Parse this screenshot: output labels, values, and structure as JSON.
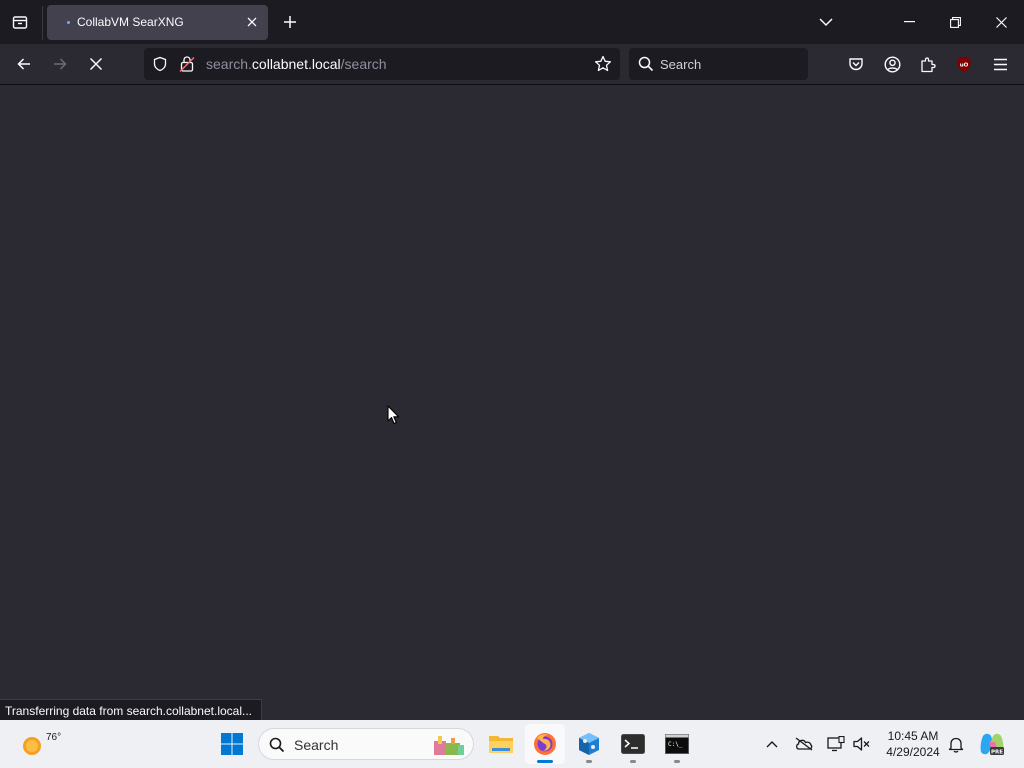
{
  "browser": {
    "tab": {
      "title": "CollabVM SearXNG"
    },
    "url": {
      "prefix": "search.",
      "host": "collabnet.local",
      "path": "/search"
    },
    "search_placeholder": "Search",
    "status_text": "Transferring data from search.collabnet.local..."
  },
  "taskbar": {
    "weather_temp": "76°",
    "search_placeholder": "Search",
    "apps": [
      "windows-start",
      "file-explorer",
      "firefox",
      "virtualbox-tools",
      "terminal",
      "command-prompt"
    ],
    "clock": {
      "time": "10:45 AM",
      "date": "4/29/2024"
    }
  },
  "colors": {
    "browser_frame": "#1c1b22",
    "page_background": "#2b2a33",
    "accent_blue": "#0078d4",
    "taskbar_bg": "#eef0f4"
  }
}
